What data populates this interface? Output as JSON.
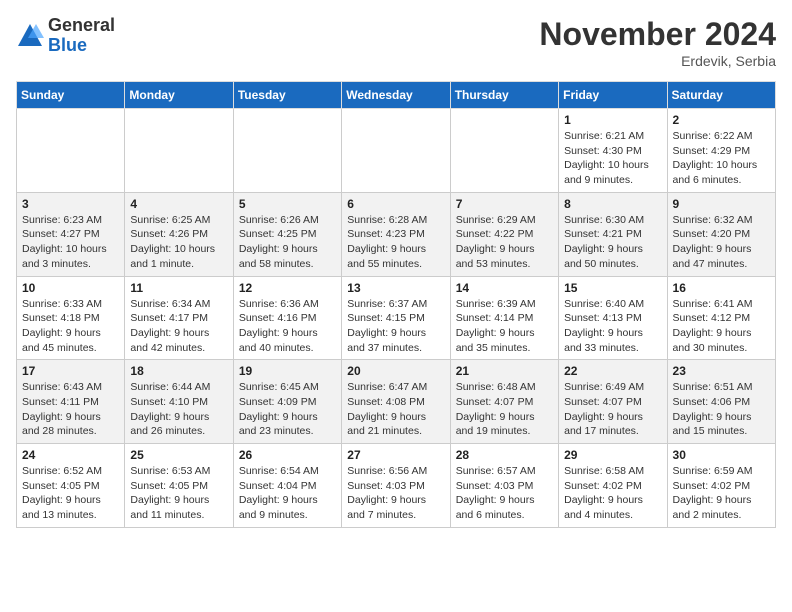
{
  "logo": {
    "general": "General",
    "blue": "Blue"
  },
  "header": {
    "month": "November 2024",
    "location": "Erdevik, Serbia"
  },
  "weekdays": [
    "Sunday",
    "Monday",
    "Tuesday",
    "Wednesday",
    "Thursday",
    "Friday",
    "Saturday"
  ],
  "weeks": [
    [
      {
        "day": "",
        "info": ""
      },
      {
        "day": "",
        "info": ""
      },
      {
        "day": "",
        "info": ""
      },
      {
        "day": "",
        "info": ""
      },
      {
        "day": "",
        "info": ""
      },
      {
        "day": "1",
        "info": "Sunrise: 6:21 AM\nSunset: 4:30 PM\nDaylight: 10 hours and 9 minutes."
      },
      {
        "day": "2",
        "info": "Sunrise: 6:22 AM\nSunset: 4:29 PM\nDaylight: 10 hours and 6 minutes."
      }
    ],
    [
      {
        "day": "3",
        "info": "Sunrise: 6:23 AM\nSunset: 4:27 PM\nDaylight: 10 hours and 3 minutes."
      },
      {
        "day": "4",
        "info": "Sunrise: 6:25 AM\nSunset: 4:26 PM\nDaylight: 10 hours and 1 minute."
      },
      {
        "day": "5",
        "info": "Sunrise: 6:26 AM\nSunset: 4:25 PM\nDaylight: 9 hours and 58 minutes."
      },
      {
        "day": "6",
        "info": "Sunrise: 6:28 AM\nSunset: 4:23 PM\nDaylight: 9 hours and 55 minutes."
      },
      {
        "day": "7",
        "info": "Sunrise: 6:29 AM\nSunset: 4:22 PM\nDaylight: 9 hours and 53 minutes."
      },
      {
        "day": "8",
        "info": "Sunrise: 6:30 AM\nSunset: 4:21 PM\nDaylight: 9 hours and 50 minutes."
      },
      {
        "day": "9",
        "info": "Sunrise: 6:32 AM\nSunset: 4:20 PM\nDaylight: 9 hours and 47 minutes."
      }
    ],
    [
      {
        "day": "10",
        "info": "Sunrise: 6:33 AM\nSunset: 4:18 PM\nDaylight: 9 hours and 45 minutes."
      },
      {
        "day": "11",
        "info": "Sunrise: 6:34 AM\nSunset: 4:17 PM\nDaylight: 9 hours and 42 minutes."
      },
      {
        "day": "12",
        "info": "Sunrise: 6:36 AM\nSunset: 4:16 PM\nDaylight: 9 hours and 40 minutes."
      },
      {
        "day": "13",
        "info": "Sunrise: 6:37 AM\nSunset: 4:15 PM\nDaylight: 9 hours and 37 minutes."
      },
      {
        "day": "14",
        "info": "Sunrise: 6:39 AM\nSunset: 4:14 PM\nDaylight: 9 hours and 35 minutes."
      },
      {
        "day": "15",
        "info": "Sunrise: 6:40 AM\nSunset: 4:13 PM\nDaylight: 9 hours and 33 minutes."
      },
      {
        "day": "16",
        "info": "Sunrise: 6:41 AM\nSunset: 4:12 PM\nDaylight: 9 hours and 30 minutes."
      }
    ],
    [
      {
        "day": "17",
        "info": "Sunrise: 6:43 AM\nSunset: 4:11 PM\nDaylight: 9 hours and 28 minutes."
      },
      {
        "day": "18",
        "info": "Sunrise: 6:44 AM\nSunset: 4:10 PM\nDaylight: 9 hours and 26 minutes."
      },
      {
        "day": "19",
        "info": "Sunrise: 6:45 AM\nSunset: 4:09 PM\nDaylight: 9 hours and 23 minutes."
      },
      {
        "day": "20",
        "info": "Sunrise: 6:47 AM\nSunset: 4:08 PM\nDaylight: 9 hours and 21 minutes."
      },
      {
        "day": "21",
        "info": "Sunrise: 6:48 AM\nSunset: 4:07 PM\nDaylight: 9 hours and 19 minutes."
      },
      {
        "day": "22",
        "info": "Sunrise: 6:49 AM\nSunset: 4:07 PM\nDaylight: 9 hours and 17 minutes."
      },
      {
        "day": "23",
        "info": "Sunrise: 6:51 AM\nSunset: 4:06 PM\nDaylight: 9 hours and 15 minutes."
      }
    ],
    [
      {
        "day": "24",
        "info": "Sunrise: 6:52 AM\nSunset: 4:05 PM\nDaylight: 9 hours and 13 minutes."
      },
      {
        "day": "25",
        "info": "Sunrise: 6:53 AM\nSunset: 4:05 PM\nDaylight: 9 hours and 11 minutes."
      },
      {
        "day": "26",
        "info": "Sunrise: 6:54 AM\nSunset: 4:04 PM\nDaylight: 9 hours and 9 minutes."
      },
      {
        "day": "27",
        "info": "Sunrise: 6:56 AM\nSunset: 4:03 PM\nDaylight: 9 hours and 7 minutes."
      },
      {
        "day": "28",
        "info": "Sunrise: 6:57 AM\nSunset: 4:03 PM\nDaylight: 9 hours and 6 minutes."
      },
      {
        "day": "29",
        "info": "Sunrise: 6:58 AM\nSunset: 4:02 PM\nDaylight: 9 hours and 4 minutes."
      },
      {
        "day": "30",
        "info": "Sunrise: 6:59 AM\nSunset: 4:02 PM\nDaylight: 9 hours and 2 minutes."
      }
    ]
  ]
}
